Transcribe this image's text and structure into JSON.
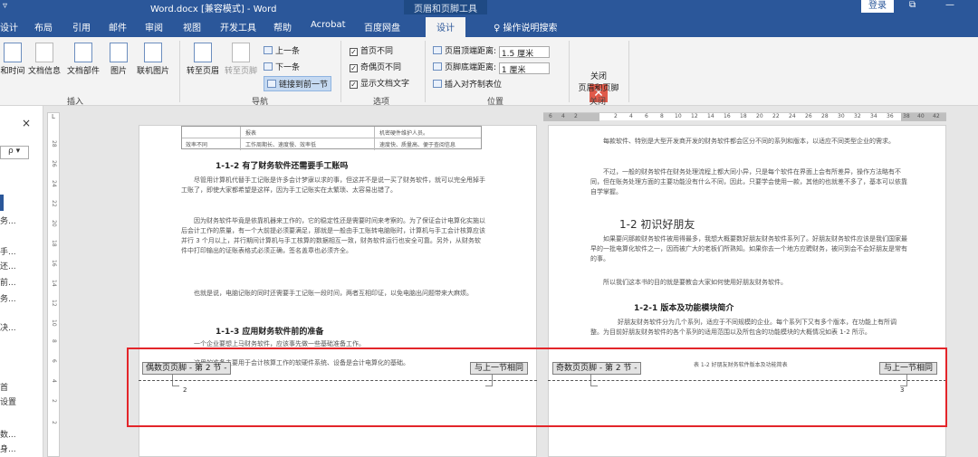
{
  "title_bar": {
    "quick_access": "▿",
    "document_title": "Word.docx [兼容模式] - Word",
    "context_tab_group": "页眉和页脚工具",
    "login": "登录",
    "restore_icon": "⧉",
    "minimize_icon": "—"
  },
  "tabs": [
    "设计",
    "布局",
    "引用",
    "邮件",
    "审阅",
    "视图",
    "开发工具",
    "帮助",
    "Acrobat",
    "百度网盘",
    "设计",
    "♀ 操作说明搜索"
  ],
  "ribbon": {
    "insert_group": {
      "label": "插入",
      "buttons": [
        "和时间",
        "文档信息",
        "文档部件",
        "图片",
        "联机图片"
      ]
    },
    "nav_group": {
      "label": "导航",
      "goto_header": "转至页眉",
      "goto_footer": "转至页脚",
      "previous": "上一条",
      "next": "下一条",
      "link_to_previous": "链接到前一节"
    },
    "options_group": {
      "label": "选项",
      "first_page": "首页不同",
      "odd_even": "奇偶页不同",
      "show_text": "显示文档文字"
    },
    "position_group": {
      "label": "位置",
      "header_from_top": "页眉顶端距离:",
      "header_value": "1.5 厘米",
      "footer_from_bottom": "页脚底端距离:",
      "footer_value": "1 厘米",
      "insert_align_tab": "插入对齐制表位"
    },
    "close_group": {
      "label": "关闭",
      "close_button_line1": "关闭",
      "close_button_line2": "页眉和页脚"
    }
  },
  "left_pane": {
    "close": "×",
    "search_icon": "ρ ▾",
    "items": [
      "务...",
      "手...",
      "还...",
      "前...",
      "务...",
      "决...",
      "首",
      "设置",
      "数...",
      "身..."
    ]
  },
  "vertical_ruler_numbers": [
    "28",
    "26",
    "24",
    "22",
    "20",
    "18",
    "16",
    "14",
    "12",
    "10",
    "8",
    "6",
    "4",
    "2",
    "2"
  ],
  "horizontal_ruler_numbers": [
    "6",
    "4",
    "2",
    "2",
    "4",
    "6",
    "8",
    "10",
    "12",
    "14",
    "16",
    "18",
    "20",
    "22",
    "24",
    "26",
    "28",
    "30",
    "32",
    "34",
    "36",
    "38",
    "40",
    "42"
  ],
  "page1": {
    "table_row1": [
      "",
      "报表",
      "",
      "机密硬件维护人员。"
    ],
    "table_row2": [
      "效率不同",
      "工作周期长、速度慢、效率低",
      "",
      "速度快、质量高、便于查阅信息"
    ],
    "heading1": "1-1-2 有了财务软件还需要手工账吗",
    "para1": "尽管用计算机代替手工记账是许多会计梦寐以求的事，但这并不是说一买了财务软件，就可以完全甩掉手工账了，即使大家都希望是这样，因为手工记账实在太繁琐、太容易出错了。",
    "para2": "因为财务软件毕竟是依靠机器来工作的，它的稳定性还是需要时间来考察的。为了保证会计电算化实施以后会计工作的质量，有一个大前提必须要满足，那就是一般由手工账转电脑账时，计算机与手工会计核算应该并行 3 个月以上，并行期间计算机与手工核算的数据相互一致，财务软件运行也安全可靠。另外，从财务软件中打印输出的证账表格式必须正确，签名盖章也必须齐全。",
    "para3": "也就是说，电脑记账的同时还需要手工记账一段时间，两者互相印证，以免电脑出问题带来大麻烦。",
    "heading2": "1-1-3 应用财务软件前的准备",
    "para4": "一个企业要想上马财务软件，应该事先做一些基础准备工作。",
    "para5": "这里的准备主要用于会计核算工作的软硬件系统、设备是会计电算化的基础。",
    "footer_label": "偶数页页脚 - 第 2 节 -",
    "same_as_previous": "与上一节相同",
    "page_number": "2"
  },
  "page2": {
    "para1": "每款软件、特别是大型开发商开发的财务软件都会区分不同的系列和版本，以适应不同类型企业的需求。",
    "para2": "不过，一般的财务软件在财务处理流程上都大同小异，只是每个软件在界面上会有所差异，操作方法略有不同，但在账务处理方面的主要功能没有什么不同，因此，只要学会使用一款，其他的也就差不多了，基本可以依靠自学掌握。",
    "heading1": "1-2 初识好朋友",
    "para3": "如果要问那款财务软件被用得最多，我想大概要数好朋友财务软件系列了。好朋友财务软件应该是我们国家最早的一批电算化软件之一，因而被广大的老板们所熟知。如果你去一个地方应聘财务，被问到会不会好朋友是常有的事。",
    "para4": "所以我们这本书的目的就是要教会大家如何使用好朋友财务软件。",
    "heading2": "1-2-1 版本及功能模块简介",
    "para5": "好朋友财务软件分为几个系列，适应于不同规模的企业。每个系列下又有多个版本，在功能上有所调整。为目前好朋友财务软件的各个系列的适用范围以及所包含的功能模块的大概情况如表 1-2 所示。",
    "caption": "表 1-2 好朋友财务软件版本及功能简表",
    "footer_label": "奇数页页脚 - 第 2 节 -",
    "same_as_previous": "与上一节相同",
    "page_number": "3"
  }
}
